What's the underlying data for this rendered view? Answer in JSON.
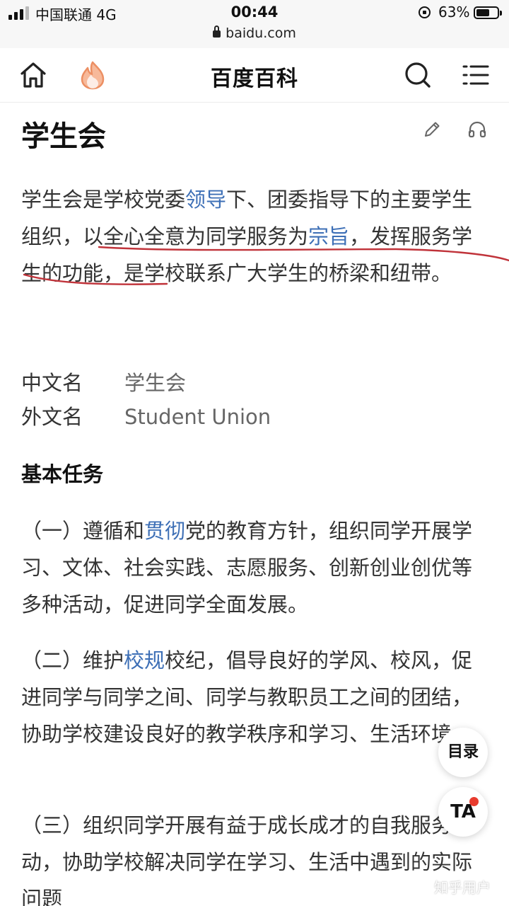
{
  "status_bar": {
    "carrier": "中国联通  4G",
    "time": "00:44",
    "url": "baidu.com",
    "battery_text": "63%",
    "battery_level": 0.63
  },
  "header": {
    "title": "百度百科"
  },
  "article": {
    "title": "学生会",
    "intro": [
      {
        "t": "学生会是学校党委"
      },
      {
        "t": "领导",
        "link": true
      },
      {
        "t": "下、团委指导下的主要学生组织，以全心全意为同学服务为"
      },
      {
        "t": "宗旨",
        "link": true
      },
      {
        "t": "，发挥服务学生的功能，是学校联系广大学生的桥梁和纽带。"
      }
    ],
    "info": [
      {
        "key": "中文名",
        "value": "学生会"
      },
      {
        "key": "外文名",
        "value": "Student Union"
      }
    ],
    "section_title": "基本任务",
    "tasks": [
      [
        {
          "t": "（一）遵循和"
        },
        {
          "t": "贯彻",
          "link": true
        },
        {
          "t": "党的教育方针，组织同学开展学习、文体、社会实践、志愿服务、创新创业创优等多种活动，促进同学全面发展。"
        }
      ],
      [
        {
          "t": "（二）维护"
        },
        {
          "t": "校规",
          "link": true
        },
        {
          "t": "校纪，倡导良好的学风、校风，促进同学与同学之间、同学与教职员工之间的团结，协助学校建设良好的教学秩序和学习、生活环境。"
        }
      ],
      [
        {
          "t": "（三）组织同学开展有益于成长成才的自我服务活动，协助学校解决同学在学习、生活中遇到的实际问题"
        }
      ]
    ]
  },
  "floating": {
    "toc_label": "目录",
    "ta_label": "TA"
  },
  "watermark": "知乎用户",
  "colors": {
    "link": "#3d6fb6",
    "annotation_red": "#c0333a",
    "flame": "#f0a070"
  }
}
